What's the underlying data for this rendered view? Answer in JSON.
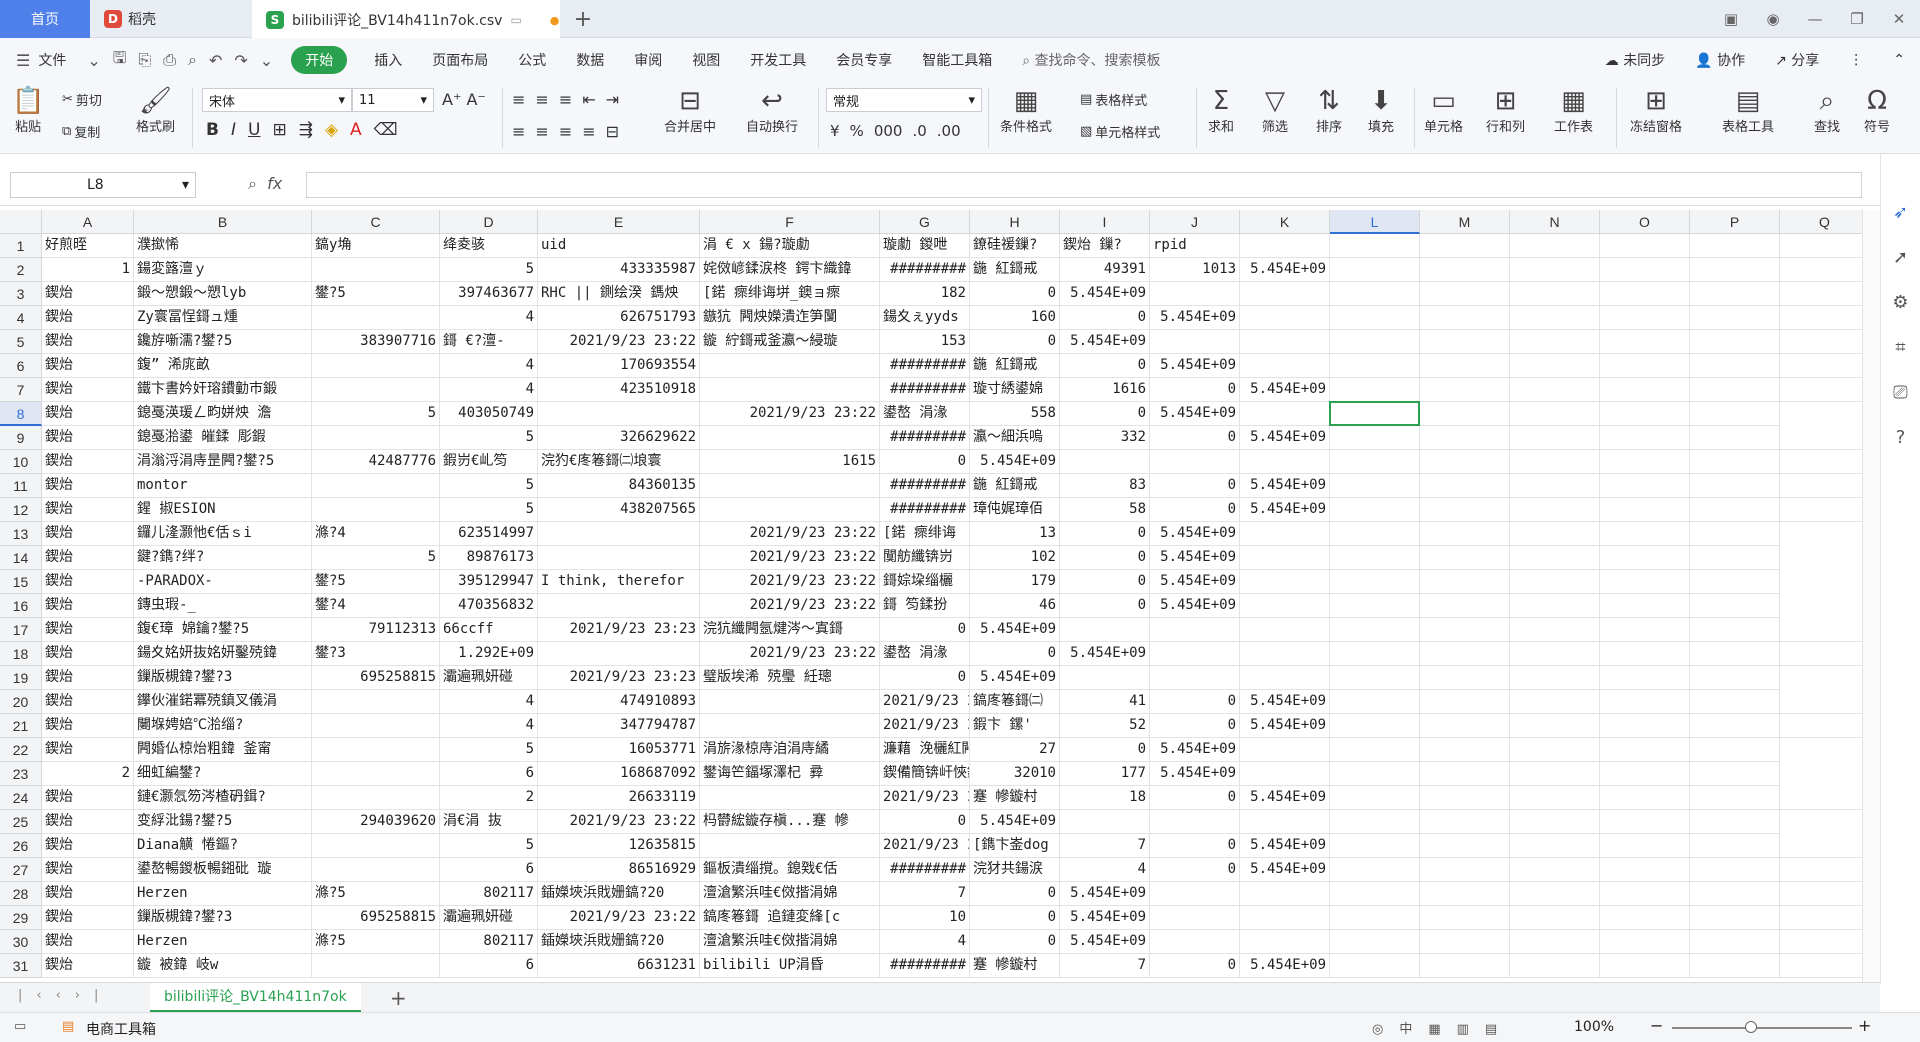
{
  "title_tabs": {
    "home": "首页",
    "daoke": "稻壳",
    "file": "bilibili评论_BV14h411n7ok.csv"
  },
  "menu": [
    "文件",
    "开始",
    "插入",
    "页面布局",
    "公式",
    "数据",
    "审阅",
    "视图",
    "开发工具",
    "会员专享",
    "智能工具箱"
  ],
  "search_placeholder": "查找命令、搜索模板",
  "right_menu": {
    "sync": "未同步",
    "collab": "协作",
    "share": "分享"
  },
  "ribbon": {
    "paste": "粘贴",
    "cut": "剪切",
    "copy": "复制",
    "format_painter": "格式刷",
    "font": "宋体",
    "font_size": "11",
    "number_format": "常规",
    "merge": "合并居中",
    "wrap": "自动换行",
    "cond_format": "条件格式",
    "table_style": "表格样式",
    "cell_style": "单元格样式",
    "sum": "求和",
    "filter": "筛选",
    "sort": "排序",
    "fill": "填充",
    "cell": "单元格",
    "rowcol": "行和列",
    "sheet": "工作表",
    "freeze": "冻结窗格",
    "table_tools": "表格工具",
    "find": "查找",
    "symbol": "符号"
  },
  "name_box": "L8",
  "fx": "fx",
  "columns": [
    "A",
    "B",
    "C",
    "D",
    "E",
    "F",
    "G",
    "H",
    "I",
    "J",
    "K",
    "L",
    "M",
    "N",
    "O",
    "P",
    "Q"
  ],
  "rows": [
    [
      "好煎晊",
      "濮撳悕",
      "鎬у埆",
      "绛夌骇",
      "uid",
      "涓   € x    鍚?璇勮",
      "璇勮   鍐呭",
      "鐐硅禐鏁?",
      "鍥炲   鏁?",
      "rpid",
      "",
      "",
      "",
      "",
      "",
      "",
      ""
    ],
    [
      "1",
      "鍚変簬澶ｙ",
      "",
      "5",
      "433335987",
      "姹傚嵃鍒涙柊   鍔卞織鍏",
      "#########",
      "鍦   紅鎶戒",
      "49391",
      "1013",
      "5.454E+09",
      "",
      "",
      "",
      "",
      "",
      ""
    ],
    [
      "鍥炲",
      "鍛～愬鍛～愬lyb",
      "鐢?5",
      "397463677",
      "RHC || 鍘绘湀  鎷炴",
      "[鍩   瘝绯诲垪_鐭ョ瘝",
      "182",
      "0",
      "5.454E+09",
      "",
      "",
      "",
      "",
      "",
      "",
      "",
      ""
    ],
    [
      "鍥炲",
      "Zy寰冨悜鎶ュ煄",
      "",
      "4",
      "626751793",
      "鏃犺   闁炴嬫潰迮笋闅",
      "鍚夊ぇyyds",
      "160",
      "0",
      "5.454E+09",
      "",
      "",
      "",
      "",
      "",
      "",
      ""
    ],
    [
      "鍥炲",
      "鑱斿噺濡?鐢?5",
      "383907716",
      "鎶   €?澶-",
      "2021/9/23 23:22",
      "鏇   紵鎶戒釜瀛～綅璇",
      "153",
      "0",
      "5.454E+09",
      "",
      "",
      "",
      "",
      "",
      "",
      "",
      ""
    ],
    [
      "鍥炲",
      "鍑”   浠庣畝",
      "",
      "4",
      "170693554",
      "",
      "#########",
      "鍦   紅鎶戒",
      "0",
      "5.454E+09",
      "",
      "",
      "",
      "",
      "",
      "",
      ""
    ],
    [
      "鍥炲",
      "鐵卞書妗奸瑢鐨勭巿鍛",
      "",
      "4",
      "423510918",
      "",
      "#########",
      "璇寸綉鍙婂",
      "1616",
      "0",
      "5.454E+09",
      "",
      "",
      "",
      "",
      "",
      ""
    ],
    [
      "鍥炲",
      "鎴戞渶瑗ㄥ畇姘炴   澹",
      "5",
      "403050749",
      "",
      "2021/9/23 23:22",
      "鍙嶅   涓湪",
      "558",
      "0",
      "5.454E+09",
      "",
      "",
      "",
      "",
      "",
      ""
    ],
    [
      "鍥炲",
      "鎴戞湁鍙   皠鍒   彫鍜",
      "",
      "5",
      "326629622",
      "",
      "#########",
      "瀛～細浜嗚",
      "332",
      "0",
      "5.454E+09",
      "",
      "",
      "",
      "",
      "",
      ""
    ],
    [
      "鍥炲",
      "涓滃浖涓庤昰闁?鐢?5",
      "42487776",
      "鍜岃€乢笉",
      "浣犳€庝箞鎶㈡埌寰",
      "1615",
      "0",
      "5.454E+09",
      "",
      "",
      "",
      "",
      "",
      "",
      "",
      "",
      ""
    ],
    [
      "鍥炲",
      "montor",
      "",
      "5",
      "84360135",
      "",
      "#########",
      "鍦   紅鎶戒",
      "83",
      "0",
      "5.454E+09",
      "",
      "",
      "",
      "",
      "",
      ""
    ],
    [
      "鍥炲",
      "鍟   掓ESION",
      "",
      "5",
      "438207565",
      "",
      "#########",
      "璋伅娓璋佰",
      "58",
      "0",
      "5.454E+09",
      "",
      "",
      "",
      "",
      "",
      ""
    ],
    [
      "鍥炲",
      "鑼儿湰灏忚€佸ｓi",
      "滌?4",
      "623514997",
      "",
      "2021/9/23 23:22",
      "[鍩   瘝绯诲",
      "13",
      "0",
      "5.454E+09",
      "",
      "",
      "",
      "",
      "",
      ""
    ],
    [
      "鍥炲",
      "鍵?鐫?绊?",
      "5",
      "89876173",
      "",
      "2021/9/23 23:22",
      "闃舫纖锛岃",
      "102",
      "0",
      "5.454E+09",
      "",
      "",
      "",
      "",
      "",
      ""
    ],
    [
      "鍥炲",
      "-PARADOX-",
      "鐢?5",
      "395129947",
      "I think, therefor",
      "2021/9/23 23:22",
      "鎶婃垜缁欐",
      "179",
      "0",
      "5.454E+09",
      "",
      "",
      "",
      "",
      "",
      ""
    ],
    [
      "鍥炲",
      "鏄虫瑕-_",
      "鐢?4",
      "470356832",
      "",
      "2021/9/23 23:22",
      "鎶   笉鍒扮",
      "46",
      "0",
      "5.454E+09",
      "",
      "",
      "",
      "",
      "",
      ""
    ],
    [
      "鍥炲",
      "鍑€璋   婂鑰?鐢?5",
      "79112313",
      "66ccff",
      "2021/9/23 23:23",
      "浣犺纖闁氬煡涔～寘鎶",
      "0",
      "5.454E+09",
      "",
      "",
      "",
      "",
      "",
      "",
      "",
      "",
      ""
    ],
    [
      "鍥炲",
      "鍚夊姳妍抜姳妍鑿殑鍏",
      "鐢?3",
      "1.292E+09",
      "",
      "2021/9/23 23:22",
      "鍙嶅   涓湪",
      "0",
      "5.454E+09",
      "",
      "",
      "",
      "",
      "",
      "",
      "",
      ""
    ],
    [
      "鍥炲",
      "鏁版槻鍏?鐢?3",
      "695258815",
      "灞遍珮妍碰",
      "2021/9/23 23:23",
      "璧版埃浠   殑璺   紝璁",
      "0",
      "5.454E+09",
      "",
      "",
      "",
      "",
      "",
      "",
      "",
      ""
    ],
    [
      "鍥炲",
      "鑻伙漼鍩冪殑鎮叉儀涓",
      "",
      "4",
      "474910893",
      "",
      "2021/9/23 23:23",
      "鎬庝箞鎶㈡",
      "41",
      "0",
      "5.454E+09",
      "",
      "",
      "",
      "",
      "",
      ""
    ],
    [
      "鍥炲",
      "闄堢娉婄℃湁缁?",
      "",
      "4",
      "347794787",
      "",
      "2021/9/23 23:23",
      "鍜卞   鏍'",
      "52",
      "0",
      "5.454E+09",
      "",
      "",
      "",
      "",
      "",
      ""
    ],
    [
      "鍥炲",
      "闁婚仏椋炲粗鍏   釜甯",
      "",
      "5",
      "16053771",
      "涓旂湪椋庤洎涓庤繘",
      "濂藉   浼欐紅闁藉   浼",
      "27",
      "0",
      "5.454E+09",
      "",
      "",
      "",
      "",
      "",
      ""
    ],
    [
      "2",
      "细虹編鐢?",
      "",
      "6",
      "168687092",
      "鐢诲笀鍢塚澤杞   彛",
      "鍥備簡锛屽悏鏋橋ぇ灏",
      "32010",
      "177",
      "5.454E+09",
      "",
      "",
      "",
      "",
      "",
      ""
    ],
    [
      "鍥炲",
      "鏈€灏忥笏涔楂砃鍓?",
      "",
      "2",
      "26633119",
      "",
      "2021/9/23 23:22",
      "蹇   幓鏇村",
      "18",
      "0",
      "5.454E+09",
      "",
      "",
      "",
      "",
      "",
      ""
    ],
    [
      "鍥炲",
      "变綒沘鍚?鐢?5",
      "294039620",
      "涓€涓   抜",
      "2021/9/23 23:22",
      "杩欎綋鏇存槇...蹇   幓",
      "0",
      "5.454E+09",
      "",
      "",
      "",
      "",
      "",
      "",
      "",
      ""
    ],
    [
      "鍥炲",
      "Diana觵   惓鏂?",
      "",
      "5",
      "12635815",
      "",
      "2021/9/23 23:22",
      "[鐫卞崟dog",
      "7",
      "0",
      "5.454E+09",
      "",
      "",
      "",
      "",
      "",
      ""
    ],
    [
      "鍥炲",
      "鍙嶅暢鍐板暢鎺砒   璇",
      "",
      "6",
      "86516929",
      "鏂板潰缁撹。鎴戣€佸",
      "#########",
      "浣犲共鍚涙",
      "4",
      "0",
      "5.454E+09",
      "",
      "",
      "",
      "",
      "",
      ""
    ],
    [
      "鍥炲",
      "Herzen",
      "滌?5",
      "802117",
      "鍤嬫埉浜戝姗鎬?20",
      "澶滄繁浜哇€傚揩涓婂",
      "7",
      "0",
      "5.454E+09",
      "",
      "",
      "",
      "",
      "",
      "",
      "",
      ""
    ],
    [
      "鍥炲",
      "鏁版槻鍏?鐢?3",
      "695258815",
      "灞遍珮妍碰",
      "2021/9/23 23:22",
      "鎬庝箞鎶   追鏈変綘[c",
      "10",
      "0",
      "5.454E+09",
      "",
      "",
      "",
      "",
      "",
      "",
      "",
      ""
    ],
    [
      "鍥炲",
      "Herzen",
      "滌?5",
      "802117",
      "鍤嬫埉浜戝姗鎬?20",
      "澶滄繁浜哇€傚揩涓婂",
      "4",
      "0",
      "5.454E+09",
      "",
      "",
      "",
      "",
      "",
      "",
      "",
      ""
    ],
    [
      "鍥炲",
      "鏇   被鍏   岐w",
      "",
      "6",
      "6631231",
      "bilibili UP涓昏",
      "#########",
      "蹇   幓鏇村",
      "7",
      "0",
      "5.454E+09",
      "",
      "",
      "",
      "",
      "",
      ""
    ]
  ],
  "sheet_tab": "bilibili评论_BV14h411n7ok",
  "status": {
    "toolbox": "电商工具箱",
    "zoom": "100%"
  }
}
